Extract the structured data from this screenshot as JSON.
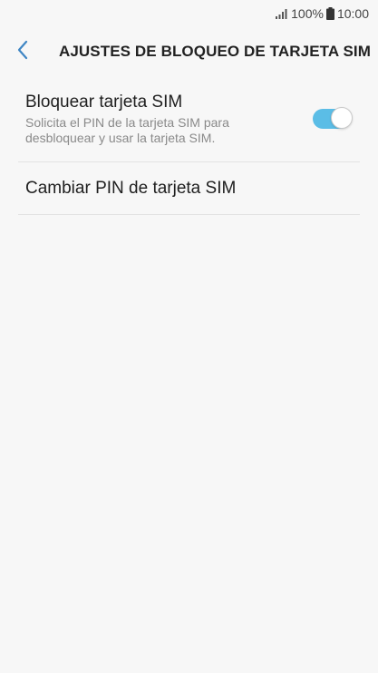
{
  "status_bar": {
    "battery": "100%",
    "time": "10:00",
    "signal_icon": "signal-bars-icon",
    "battery_icon": "battery-icon"
  },
  "header": {
    "title": "AJUSTES DE BLOQUEO DE TARJETA SIM",
    "back_icon": "chevron-left-icon"
  },
  "settings": {
    "lock_sim": {
      "title": "Bloquear tarjeta SIM",
      "subtitle": "Solicita el PIN de la tarjeta SIM para desbloquear y usar la tarjeta SIM.",
      "enabled": true
    },
    "change_pin": {
      "title": "Cambiar PIN de tarjeta SIM"
    }
  },
  "colors": {
    "accent": "#5bbde6",
    "background": "#f7f7f7",
    "back_arrow": "#3f86c4"
  }
}
